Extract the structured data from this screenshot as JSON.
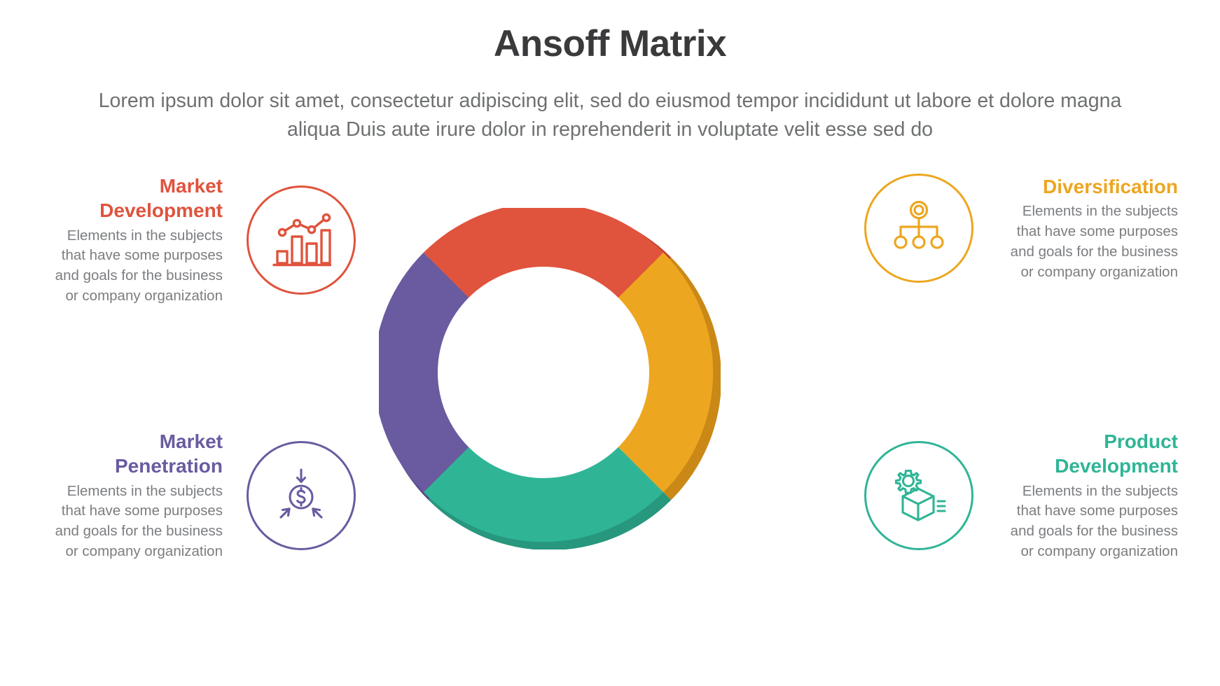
{
  "header": {
    "title": "Ansoff Matrix",
    "subtitle": "Lorem ipsum dolor sit amet, consectetur adipiscing elit, sed do eiusmod tempor incididunt ut labore et dolore magna aliqua Duis aute irure dolor in reprehenderit in voluptate velit esse sed do"
  },
  "body_text": "Elements in the subjects\nthat have some purposes\nand goals for the  business\nor company organization",
  "colors": {
    "red": "#e0533d",
    "amber": "#eda620",
    "teal": "#2fb596",
    "purple": "#6a5ba0",
    "red_dark": "#c2452f",
    "amber_dark": "#ca8816",
    "teal_dark": "#27977d",
    "purple_dark": "#564a85",
    "title_gray": "#3a3a3c",
    "text_gray": "#7b7d80"
  },
  "quadrants": [
    {
      "id": "market-development",
      "title": "Market\nDevelopment",
      "desc": "Elements in the subjects\nthat have some purposes\nand goals for the  business\nor company organization",
      "color": "#e0533d",
      "icon": "bar-chart-growth-icon",
      "position": "top-left"
    },
    {
      "id": "diversification",
      "title": "Diversification",
      "desc": "Elements in the subjects\nthat have some purposes\nand goals for the  business\nor company organization",
      "color": "#eda620",
      "icon": "org-chart-hierarchy-icon",
      "position": "top-right"
    },
    {
      "id": "market-penetration",
      "title": "Market\nPenetration",
      "desc": "Elements in the subjects\nthat have some purposes\nand goals for the  business\nor company organization",
      "color": "#6a5ba0",
      "icon": "dollar-coin-arrows-icon",
      "position": "bottom-left"
    },
    {
      "id": "product-development",
      "title": "Product\nDevelopment",
      "desc": "Elements in the subjects\nthat have some purposes\nand goals for the  business\nor company organization",
      "color": "#2fb596",
      "icon": "box-gear-icon",
      "position": "bottom-right"
    }
  ],
  "chart_data": {
    "type": "pie",
    "title": "Ansoff Matrix",
    "subtype": "donut-4-quadrant",
    "categories": [
      "Market Development",
      "Diversification",
      "Product Development",
      "Market Penetration"
    ],
    "values": [
      25,
      25,
      25,
      25
    ],
    "colors": [
      "#e0533d",
      "#eda620",
      "#2fb596",
      "#6a5ba0"
    ],
    "segment_angles_deg": [
      {
        "name": "Market Development",
        "start": 315,
        "end": 45,
        "quadrant": "top-left"
      },
      {
        "name": "Diversification",
        "start": 45,
        "end": 135,
        "quadrant": "top-right"
      },
      {
        "name": "Product Development",
        "start": 135,
        "end": 225,
        "quadrant": "bottom-right"
      },
      {
        "name": "Market Penetration",
        "start": 225,
        "end": 315,
        "quadrant": "bottom-left"
      }
    ],
    "legend": "off",
    "grid": "off",
    "inner_radius_ratio": 0.62
  }
}
